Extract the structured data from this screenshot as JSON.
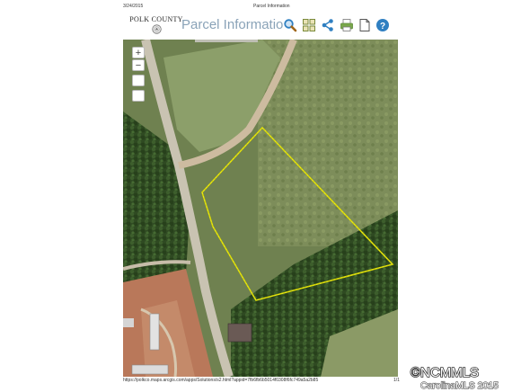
{
  "print_header": {
    "date": "3/24/2015",
    "title": "Parcel Information"
  },
  "app": {
    "logo_text": "POLK COUNTY",
    "title": "Parcel Informatio",
    "toolbar": [
      {
        "name": "search-icon",
        "color": "#2f7fc1"
      },
      {
        "name": "grid-icon",
        "color": "#7a8a3a"
      },
      {
        "name": "share-icon",
        "color": "#2f7fc1"
      },
      {
        "name": "print-icon",
        "color": "#5e8a3a"
      },
      {
        "name": "document-icon",
        "color": "#555555"
      },
      {
        "name": "help-icon",
        "color": "#2f7fc1"
      }
    ]
  },
  "map": {
    "zoom_in": "+",
    "zoom_out": "−",
    "parcel_outline_color": "#d8d800"
  },
  "footer": {
    "url": "https://polkco.maps.arcgis.com/apps/Solutions/s2.html?appid=7fb6fb6b5014f0308f6fc749a5a2b85",
    "page": "1/1"
  },
  "watermark": {
    "line1": "©NCMMLS",
    "line2": "CarolinaMLS 2015"
  }
}
